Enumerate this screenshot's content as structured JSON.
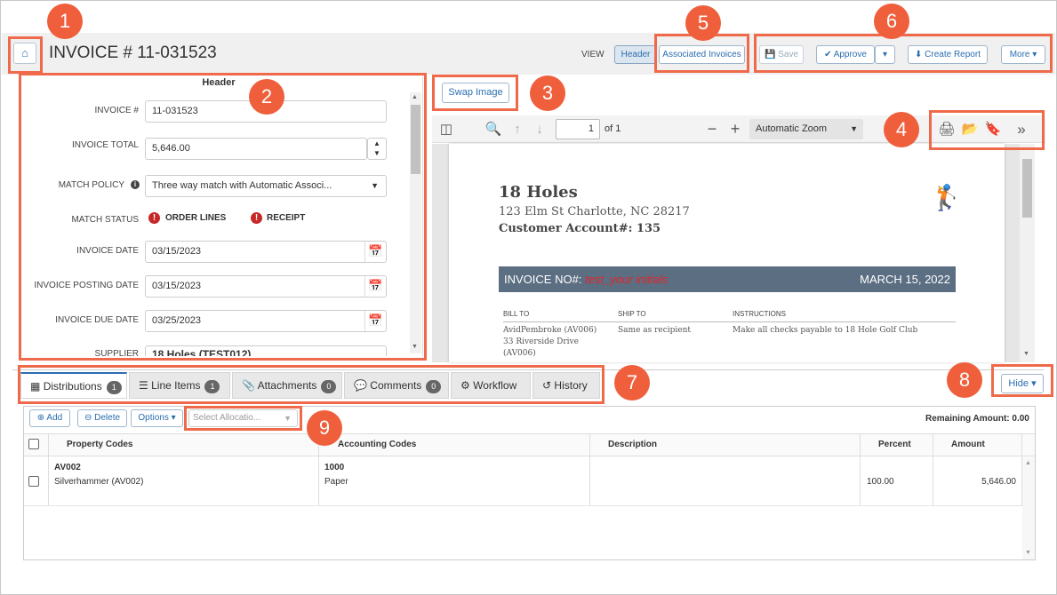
{
  "header": {
    "home_icon": "home-icon",
    "title": "INVOICE # 11-031523",
    "view_label": "VIEW",
    "view_header": "Header",
    "view_associated": "Associated Invoices",
    "save": "Save",
    "approve": "Approve",
    "create_report": "Create Report",
    "more": "More"
  },
  "form": {
    "section_title": "Header",
    "invoice_no_label": "INVOICE #",
    "invoice_no": "11-031523",
    "total_label": "INVOICE TOTAL",
    "total": "5,646.00",
    "policy_label": "MATCH POLICY",
    "policy": "Three way match with Automatic Associ...",
    "status_label": "MATCH STATUS",
    "status_order": "ORDER LINES",
    "status_receipt": "RECEIPT",
    "date_label": "INVOICE DATE",
    "date": "03/15/2023",
    "posting_label": "INVOICE POSTING DATE",
    "posting": "03/15/2023",
    "due_label": "INVOICE DUE DATE",
    "due": "03/25/2023",
    "supplier_label": "SUPPLIER",
    "supplier": "18 Holes (TEST012)"
  },
  "pdf": {
    "swap": "Swap Image",
    "page": "1",
    "of": "of 1",
    "zoom": "Automatic Zoom",
    "company": "18 Holes",
    "address": "123 Elm St Charlotte, NC 28217",
    "account": "Customer Account#: 135",
    "invoice_no_label": "INVOICE NO#:",
    "invoice_no_value": "test_your initials",
    "invoice_date": "MARCH 15, 2022",
    "bill_to": "BILL TO",
    "ship_to": "SHIP TO",
    "instructions": "INSTRUCTIONS",
    "bill_line1": "AvidPembroke (AV006)",
    "bill_line2": "33 Riverside Drive",
    "bill_line3": "(AV006)",
    "ship_value": "Same as recipient",
    "instr_value": "Make all checks payable to 18 Hole Golf Club"
  },
  "tabs": {
    "distributions": "Distributions",
    "distributions_count": "1",
    "line_items": "Line Items",
    "line_items_count": "1",
    "attachments": "Attachments",
    "attachments_count": "0",
    "comments": "Comments",
    "comments_count": "0",
    "workflow": "Workflow",
    "history": "History",
    "hide": "Hide"
  },
  "grid": {
    "add": "Add",
    "delete": "Delete",
    "options": "Options",
    "allocation_placeholder": "Select Allocatio...",
    "remaining": "Remaining Amount: 0.00",
    "col_property": "Property Codes",
    "col_accounting": "Accounting Codes",
    "col_description": "Description",
    "col_percent": "Percent",
    "col_amount": "Amount",
    "row_property_code": "AV002",
    "row_property_name": "Silverhammer (AV002)",
    "row_account_code": "1000",
    "row_account_name": "Paper",
    "row_description": "",
    "row_percent": "100.00",
    "row_amount": "5,646.00"
  },
  "callouts": [
    "1",
    "2",
    "3",
    "4",
    "5",
    "6",
    "7",
    "8",
    "9"
  ],
  "colors": {
    "callout": "#ef5f3c",
    "accent": "#2a6db0",
    "invoice_bar": "#5b6e82",
    "error": "#c62828"
  }
}
